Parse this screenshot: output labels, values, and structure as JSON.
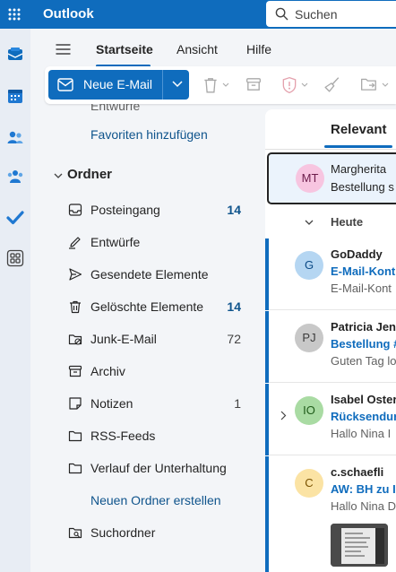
{
  "app": {
    "title": "Outlook",
    "brand_color": "#0f6cbd"
  },
  "search": {
    "placeholder": "Suchen"
  },
  "menu": {
    "tabs": [
      "Startseite",
      "Ansicht",
      "Hilfe"
    ],
    "active": "Startseite"
  },
  "toolbar": {
    "new_mail_label": "Neue E-Mail"
  },
  "rail": {
    "icons": [
      "mail-icon",
      "calendar-icon",
      "people-icon",
      "groups-icon",
      "todo-icon",
      "apps-icon"
    ]
  },
  "folders": {
    "partial_item": "Entwürfe",
    "add_favorite": "Favoriten hinzufügen",
    "section_title": "Ordner",
    "items": [
      {
        "label": "Posteingang",
        "count": "14",
        "icon": "inbox-icon"
      },
      {
        "label": "Entwürfe",
        "count": "",
        "icon": "pencil-icon"
      },
      {
        "label": "Gesendete Elemente",
        "count": "",
        "icon": "send-icon"
      },
      {
        "label": "Gelöschte Elemente",
        "count": "14",
        "icon": "trash-icon"
      },
      {
        "label": "Junk-E-Mail",
        "count": "72",
        "icon": "junk-icon"
      },
      {
        "label": "Archiv",
        "count": "",
        "icon": "archive-icon"
      },
      {
        "label": "Notizen",
        "count": "1",
        "icon": "notes-icon"
      },
      {
        "label": "RSS-Feeds",
        "count": "",
        "icon": "folder-icon"
      },
      {
        "label": "Verlauf der Unterhaltung",
        "count": "",
        "icon": "folder-icon"
      }
    ],
    "new_folder": "Neuen Ordner erstellen",
    "search_folder": "Suchordner"
  },
  "messages": {
    "tab": "Relevant",
    "pinned": {
      "initials": "MT",
      "sender": "Margherita",
      "preview": "Bestellung s",
      "avatar_color": "#f7c5e0"
    },
    "group": "Heute",
    "list": [
      {
        "initials": "G",
        "sender": "GoDaddy",
        "subject": "E-Mail-Kont",
        "preview": "E-Mail-Kont",
        "avatar_color": "#b5d6f2",
        "text_color": "#0b4a86"
      },
      {
        "initials": "PJ",
        "sender": "Patricia Jenn",
        "subject": "Bestellung #",
        "preview": "Guten Tag lo",
        "avatar_color": "#c8c8c8",
        "text_color": "#3b3b3b"
      },
      {
        "initials": "IO",
        "sender": "Isabel Oster",
        "subject": "Rücksendur",
        "preview": "Hallo Nina I",
        "avatar_color": "#a9dba3",
        "text_color": "#1e5b19"
      },
      {
        "initials": "C",
        "sender": "c.schaefli",
        "subject": "AW: BH zu I",
        "preview": "Hallo Nina D",
        "avatar_color": "#fbe3a4",
        "text_color": "#7a5200"
      }
    ]
  }
}
